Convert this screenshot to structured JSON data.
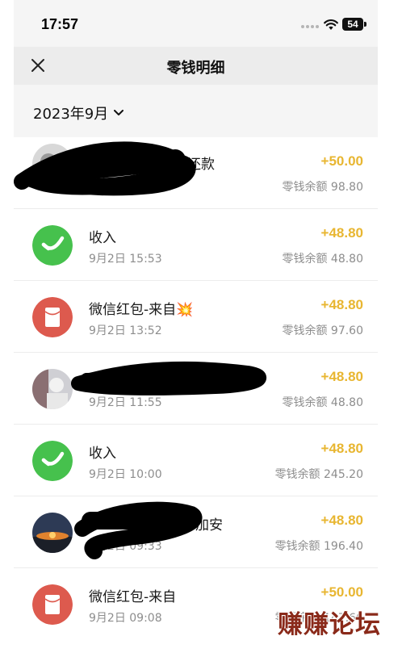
{
  "status_bar": {
    "time": "17:57",
    "battery": "54"
  },
  "header": {
    "title": "零钱明细"
  },
  "filter": {
    "month": "2023年9月"
  },
  "transactions": [
    {
      "title": "还款",
      "date": "",
      "amount": "+50.00",
      "balance": "零钱余额 98.80",
      "avatar": "photo"
    },
    {
      "title": "收入",
      "date": "9月2日 15:53",
      "amount": "+48.80",
      "balance": "零钱余额 48.80",
      "avatar": "wechat-pay-icon"
    },
    {
      "title": "微信红包-来自💥",
      "date": "9月2日 13:52",
      "amount": "+48.80",
      "balance": "零钱余额 97.60",
      "avatar": "red-envelope-icon"
    },
    {
      "title": "",
      "date": "9月2日 11:55",
      "amount": "+48.80",
      "balance": "零钱余额 48.80",
      "avatar": "photo"
    },
    {
      "title": "收入",
      "date": "9月2日 10:00",
      "amount": "+48.80",
      "balance": "零钱余额 245.20",
      "avatar": "wechat-pay-icon"
    },
    {
      "title": "加安",
      "date": "9月2日 09:33",
      "amount": "+48.80",
      "balance": "零钱余额 196.40",
      "avatar": "photo"
    },
    {
      "title": "微信红包-来自",
      "date": "9月2日 09:08",
      "amount": "+50.00",
      "balance": "零钱余额 147.60",
      "avatar": "red-envelope-icon"
    }
  ],
  "watermark": "赚赚论坛",
  "colors": {
    "amount": "#e8b631",
    "wechat_green": "#46c14d",
    "red_envelope": "#dd5a4e"
  }
}
